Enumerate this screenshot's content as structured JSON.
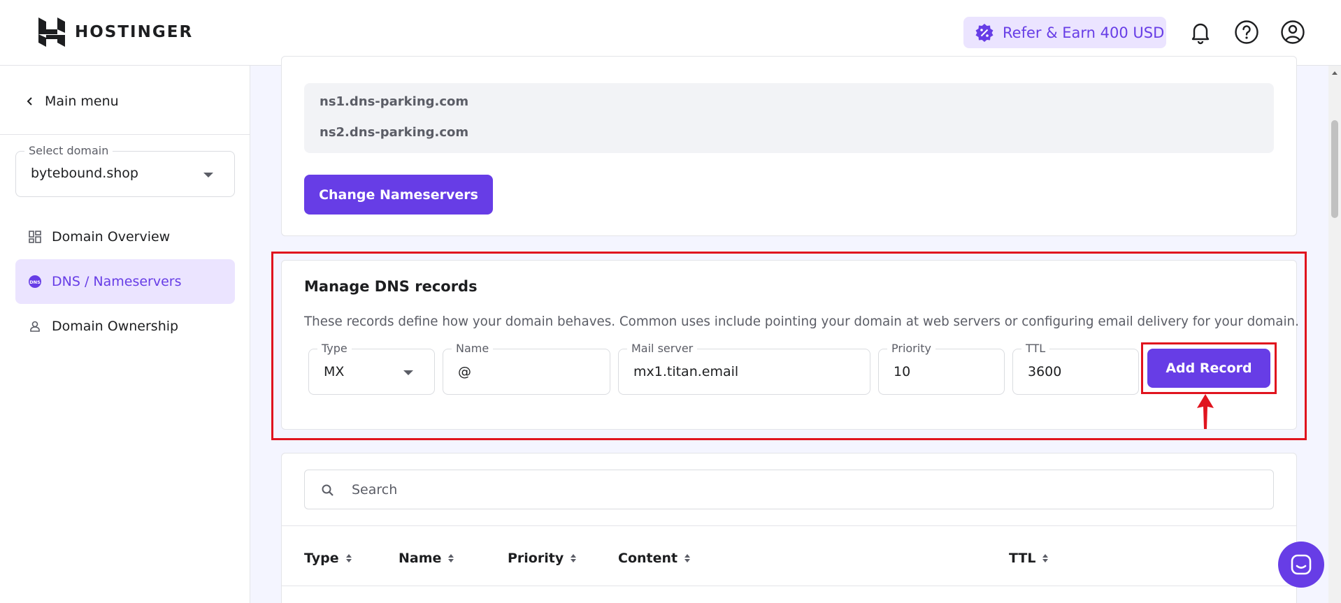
{
  "header": {
    "logo_text": "HOSTINGER",
    "refer_label": "Refer & Earn 400 USD",
    "icons": [
      "bell-icon",
      "help-icon",
      "account-icon"
    ]
  },
  "sidebar": {
    "main_menu": "Main menu",
    "select_domain": {
      "legend": "Select domain",
      "value": "bytebound.shop"
    },
    "items": [
      {
        "label": "Domain Overview",
        "icon": "grid-icon",
        "active": false
      },
      {
        "label": "DNS / Nameservers",
        "icon": "dns-icon",
        "active": true
      },
      {
        "label": "Domain Ownership",
        "icon": "person-icon",
        "active": false
      }
    ]
  },
  "nameservers": {
    "lines": [
      "ns1.dns-parking.com",
      "ns2.dns-parking.com"
    ],
    "change_button": "Change Nameservers"
  },
  "manage_dns": {
    "title": "Manage DNS records",
    "description": "These records define how your domain behaves. Common uses include pointing your domain at web servers or configuring email delivery for your domain.",
    "fields": {
      "type": {
        "legend": "Type",
        "value": "MX"
      },
      "name": {
        "legend": "Name",
        "value": "@"
      },
      "mail_server": {
        "legend": "Mail server",
        "value": "mx1.titan.email"
      },
      "priority": {
        "legend": "Priority",
        "value": "10"
      },
      "ttl": {
        "legend": "TTL",
        "value": "3600"
      }
    },
    "add_button": "Add Record"
  },
  "records_table": {
    "search_placeholder": "Search",
    "columns": [
      "Type",
      "Name",
      "Priority",
      "Content",
      "TTL"
    ]
  },
  "colors": {
    "accent": "#673de6",
    "accent_light": "#ebe4ff",
    "highlight": "#e0141e"
  }
}
